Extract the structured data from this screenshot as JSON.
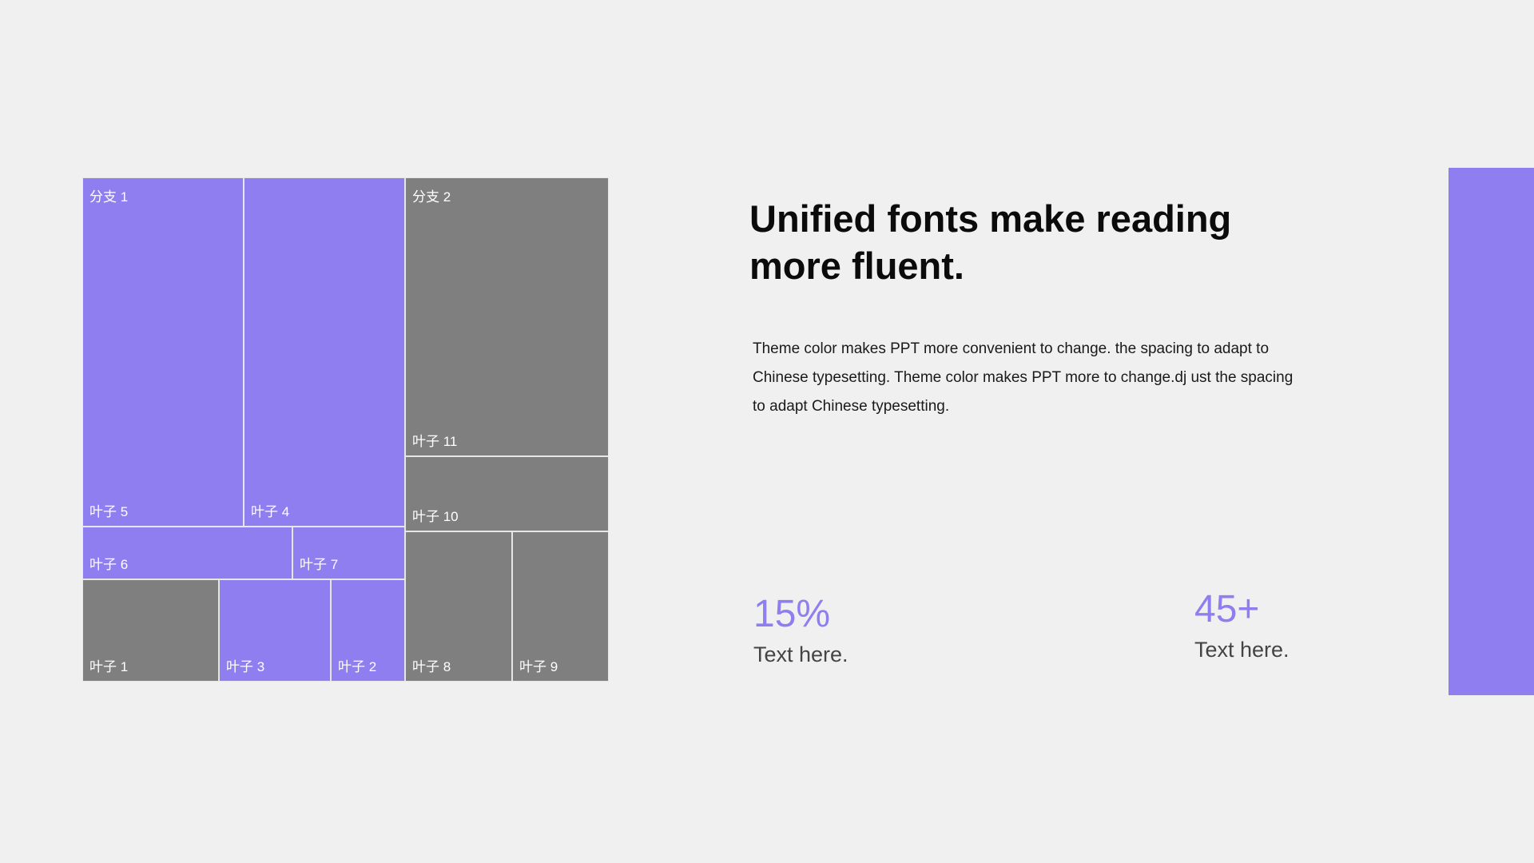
{
  "colors": {
    "accent": "#8f7ef0",
    "gray": "#7f7f7f",
    "background": "#f0f0f0"
  },
  "chart_data": {
    "type": "treemap",
    "branches": [
      {
        "name": "分支 1",
        "color": "#8f7ef0",
        "leaves": [
          {
            "name": "叶子 5"
          },
          {
            "name": "叶子 4"
          },
          {
            "name": "叶子 6"
          },
          {
            "name": "叶子 7"
          },
          {
            "name": "叶子 1",
            "color": "#7f7f7f"
          },
          {
            "name": "叶子 3"
          },
          {
            "name": "叶子 2"
          }
        ]
      },
      {
        "name": "分支 2",
        "color": "#7f7f7f",
        "leaves": [
          {
            "name": "叶子 11"
          },
          {
            "name": "叶子 10"
          },
          {
            "name": "叶子 8"
          },
          {
            "name": "叶子 9"
          }
        ]
      }
    ]
  },
  "content": {
    "title_line1": "Unified fonts make reading",
    "title_line2": "more fluent.",
    "body": "Theme  color makes PPT more convenient to change. the spacing to adapt to Chinese typesetting. Theme  color makes PPT more to change.dj ust the spacing to adapt Chinese typesetting.",
    "stats": [
      {
        "value": "15%",
        "label": "Text here."
      },
      {
        "value": "45+",
        "label": "Text here."
      }
    ]
  }
}
